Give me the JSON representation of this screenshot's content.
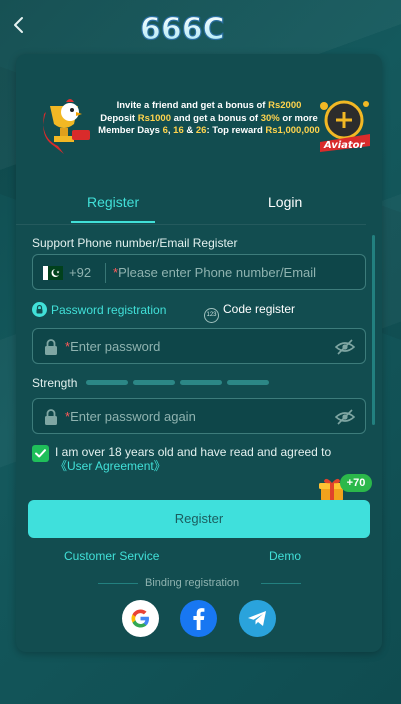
{
  "header": {
    "logo_text": "666C"
  },
  "banner": {
    "line1_pre": "Invite a friend and get a bonus of ",
    "line1_amount": "Rs2000",
    "line2_pre": "Deposit ",
    "line2_amount": "Rs1000",
    "line2_mid": " and get a bonus of ",
    "line2_pct": "30%",
    "line2_post": " or more",
    "line3_pre": "Member Days ",
    "line3_d1": "6",
    "line3_sep1": ", ",
    "line3_d2": "16",
    "line3_sep2": " & ",
    "line3_d3": "26",
    "line3_mid": ": Top reward ",
    "line3_amount": "Rs1,000,000",
    "aviator_label": "Aviator"
  },
  "tabs": {
    "register": "Register",
    "login": "Login",
    "active": "register"
  },
  "form": {
    "section_label": "Support Phone number/Email Register",
    "country_code": "+92",
    "phone_placeholder": "Please enter Phone number/Email",
    "required_mark": "*",
    "mode_password": "Password registration",
    "mode_code": "Code register",
    "mode_code_icon_text": "123",
    "password_placeholder": "Enter password",
    "strength_label": "Strength",
    "strength_bars": 4,
    "password_again_placeholder": "Enter password again",
    "agree_checked": true,
    "agree_text": "I am over 18 years old and have read and agreed to",
    "agree_link": "《User Agreement》",
    "gift_badge": "+70",
    "register_button": "Register"
  },
  "footer": {
    "customer_service": "Customer Service",
    "demo": "Demo",
    "binding_label": "Binding registration",
    "social": [
      "google",
      "facebook",
      "telegram"
    ]
  },
  "colors": {
    "accent": "#41e0d8",
    "button_bg": "#3fe0dc",
    "card_bg": "#124d50",
    "highlight": "#ffd34d",
    "required": "#ff5a5a",
    "checkbox": "#1fbf5a"
  }
}
